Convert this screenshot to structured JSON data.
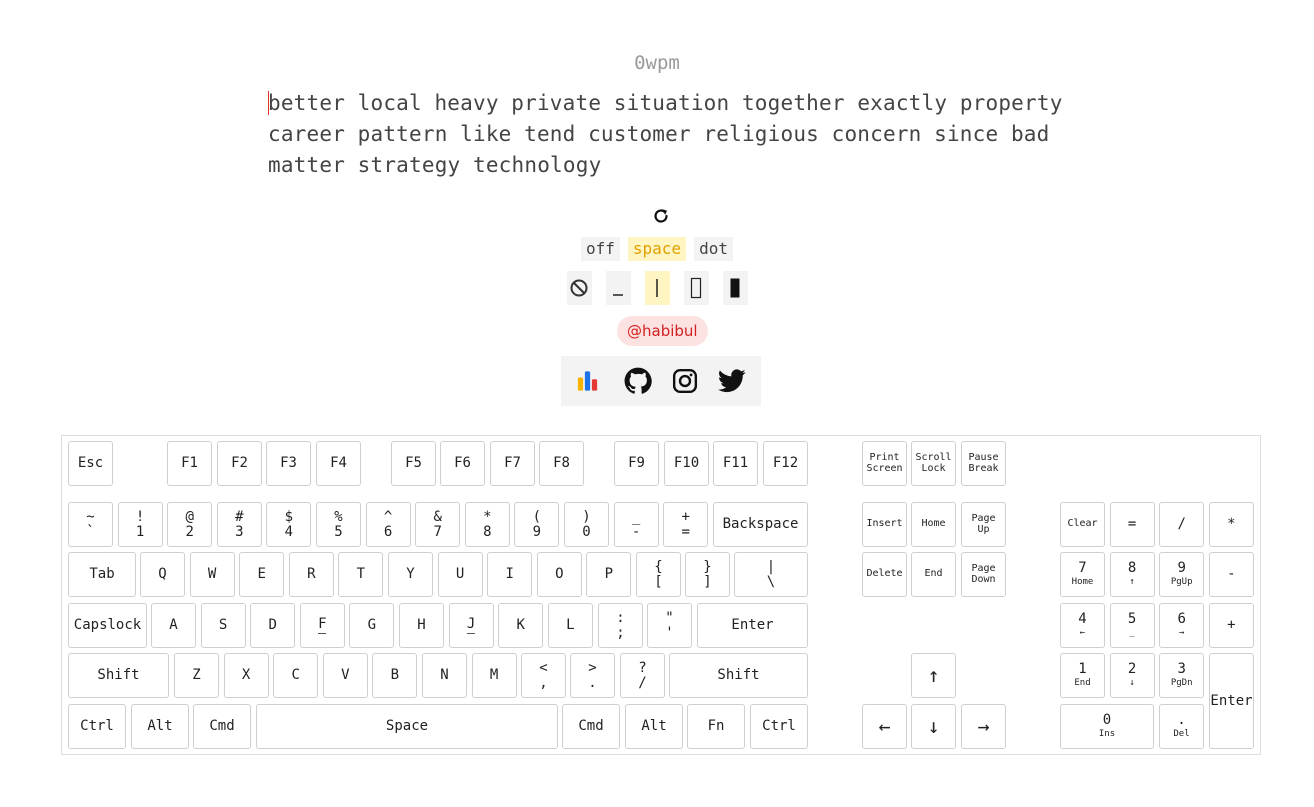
{
  "wpm": "0wpm",
  "text_lines": [
    [
      "better",
      "local",
      "heavy",
      "private",
      "situation",
      "together",
      "exactly",
      "property"
    ],
    [
      "career",
      "pattern",
      "like",
      "tend",
      "customer",
      "religious",
      "concern",
      "since",
      "bad"
    ],
    [
      "matter",
      "strategy",
      "technology"
    ]
  ],
  "sound_options": [
    "off",
    "space",
    "dot"
  ],
  "sound_selected": "space",
  "caret_styles": [
    "none",
    "underline",
    "line",
    "block-outline",
    "block"
  ],
  "caret_selected": "line",
  "author_handle": "@habibul",
  "social_links": [
    "stats-icon",
    "github-icon",
    "instagram-icon",
    "twitter-icon"
  ],
  "colors": {
    "accent_yellow": "#fff5c2",
    "accent_text": "#e0a100",
    "handle_bg": "#fde2e2",
    "handle_text": "#d21f1f",
    "caret": "#d33"
  },
  "keyboard": {
    "fn_row": [
      "Esc",
      "F1",
      "F2",
      "F3",
      "F4",
      "F5",
      "F6",
      "F7",
      "F8",
      "F9",
      "F10",
      "F11",
      "F12"
    ],
    "sys": [
      [
        "Print",
        "Screen"
      ],
      [
        "Scroll",
        "Lock"
      ],
      [
        "Pause",
        "Break"
      ]
    ],
    "num_row": [
      [
        "~",
        "`"
      ],
      [
        "!",
        "1"
      ],
      [
        "@",
        "2"
      ],
      [
        "#",
        "3"
      ],
      [
        "$",
        "4"
      ],
      [
        "%",
        "5"
      ],
      [
        "^",
        "6"
      ],
      [
        "&",
        "7"
      ],
      [
        "*",
        "8"
      ],
      [
        "(",
        "9"
      ],
      [
        ")",
        "0"
      ],
      [
        "_",
        "-"
      ],
      [
        "+",
        "="
      ]
    ],
    "backspace": "Backspace",
    "tab": "Tab",
    "qwerty": [
      "Q",
      "W",
      "E",
      "R",
      "T",
      "Y",
      "U",
      "I",
      "O",
      "P"
    ],
    "brackets": [
      [
        "{",
        "["
      ],
      [
        "}",
        "]"
      ],
      [
        "|",
        "\\"
      ]
    ],
    "capslock": "Capslock",
    "home_row": [
      "A",
      "S",
      "D",
      "F",
      "G",
      "H",
      "J",
      "K",
      "L"
    ],
    "punct_home": [
      [
        ":",
        ";"
      ],
      [
        "\"",
        "'"
      ]
    ],
    "enter": "Enter",
    "shift": "Shift",
    "bottom_row": [
      "Z",
      "X",
      "C",
      "V",
      "B",
      "N",
      "M"
    ],
    "punct_bottom": [
      [
        "<",
        ","
      ],
      [
        ">",
        "."
      ],
      [
        "?",
        "/"
      ]
    ],
    "ctrl": "Ctrl",
    "alt": "Alt",
    "cmd": "Cmd",
    "space": "Space",
    "fn": "Fn",
    "nav1": [
      "Insert",
      "Home",
      [
        "Page",
        "Up"
      ]
    ],
    "nav2": [
      "Delete",
      "End",
      [
        "Page",
        "Down"
      ]
    ],
    "arrows": [
      "↑",
      "←",
      "↓",
      "→"
    ],
    "numpad_top": [
      "Clear",
      "=",
      "/",
      "*"
    ],
    "numpad_r1": [
      [
        "7",
        "Home"
      ],
      [
        "8",
        "↑"
      ],
      [
        "9",
        "PgUp"
      ],
      [
        "-",
        ""
      ]
    ],
    "numpad_r2": [
      [
        "4",
        "←"
      ],
      [
        "5",
        "_"
      ],
      [
        "6",
        "→"
      ],
      [
        "+",
        ""
      ]
    ],
    "numpad_r3": [
      [
        "1",
        "End"
      ],
      [
        "2",
        "↓"
      ],
      [
        "3",
        "PgDn"
      ]
    ],
    "numpad_r4": [
      [
        "0",
        "Ins"
      ],
      [
        ".",
        "Del"
      ]
    ],
    "numpad_enter": "Enter"
  }
}
